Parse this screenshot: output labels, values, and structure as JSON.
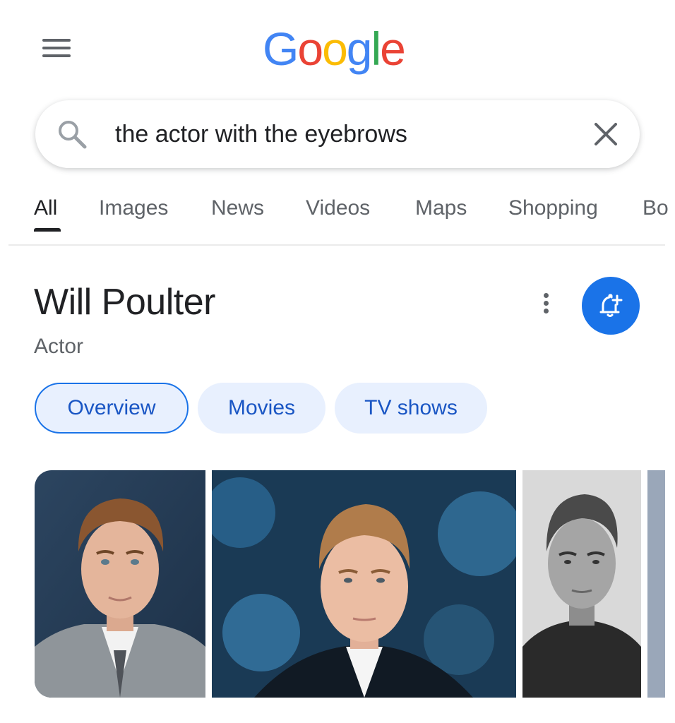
{
  "header": {
    "logo": {
      "letters": [
        "G",
        "o",
        "o",
        "g",
        "l",
        "e"
      ],
      "colors": [
        "#4285f4",
        "#ea4335",
        "#fbbc05",
        "#4285f4",
        "#34a853",
        "#ea4335"
      ]
    },
    "menu_icon": "hamburger-menu-icon"
  },
  "search": {
    "value": "the actor with the eyebrows",
    "search_icon": "search-icon",
    "clear_icon": "close-icon"
  },
  "tabs": [
    {
      "label": "All",
      "active": true
    },
    {
      "label": "Images",
      "active": false
    },
    {
      "label": "News",
      "active": false
    },
    {
      "label": "Videos",
      "active": false
    },
    {
      "label": "Maps",
      "active": false
    },
    {
      "label": "Shopping",
      "active": false
    },
    {
      "label": "Bo",
      "active": false
    }
  ],
  "entity": {
    "title": "Will Poulter",
    "subtitle": "Actor",
    "more_icon": "more-vert-icon",
    "follow_icon": "bell-add-icon"
  },
  "chips": [
    {
      "label": "Overview",
      "selected": true
    },
    {
      "label": "Movies",
      "selected": false
    },
    {
      "label": "TV shows",
      "selected": false
    }
  ],
  "colors": {
    "accent": "#1a73e8",
    "chip_bg": "#e8f0fe",
    "chip_text": "#1a56c4",
    "muted_text": "#5f6368"
  }
}
